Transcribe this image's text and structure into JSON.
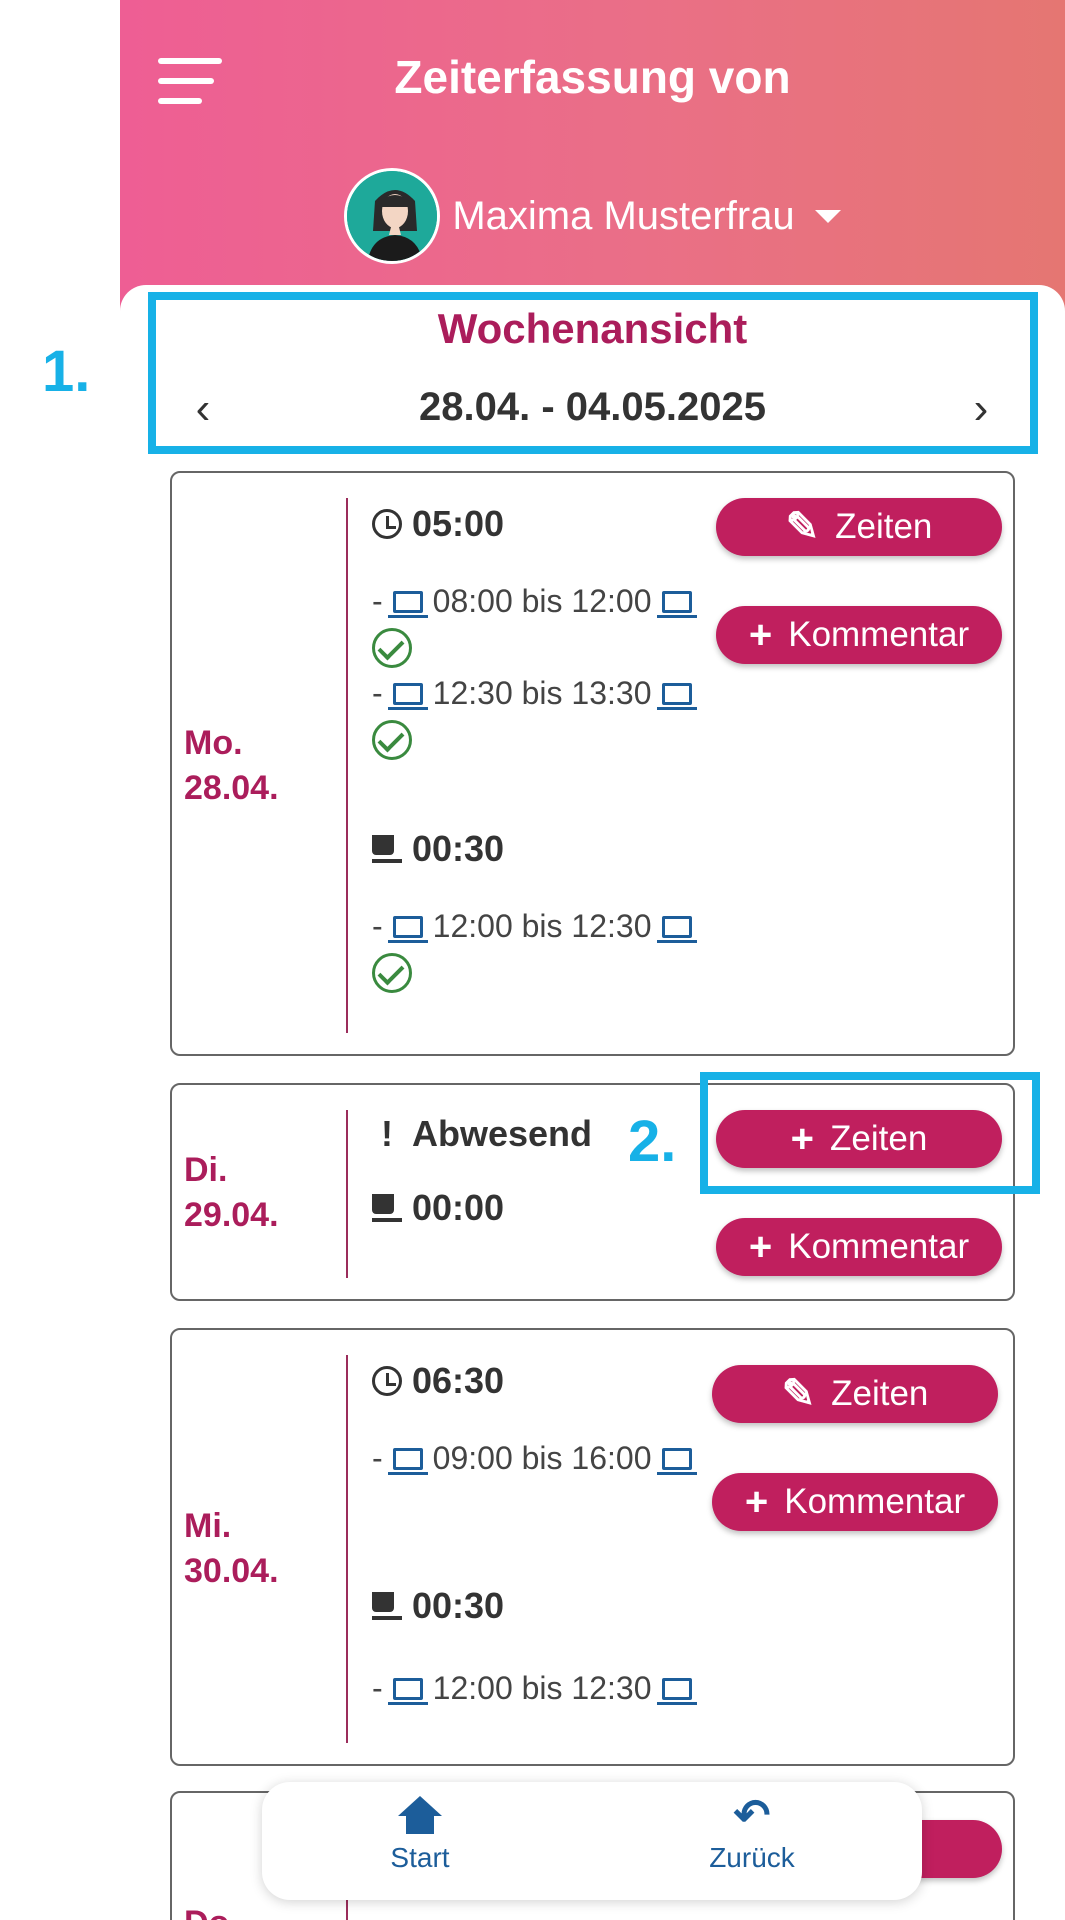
{
  "header": {
    "title": "Zeiterfassung von",
    "user_name": "Maxima Musterfrau"
  },
  "week": {
    "title": "Wochenansicht",
    "range": "28.04. - 04.05.2025",
    "prev": "‹",
    "next": "›"
  },
  "markers": {
    "one": "1.",
    "two": "2."
  },
  "days": [
    {
      "weekday": "Mo.",
      "date": "28.04.",
      "work_total": "05:00",
      "break_total": "00:30",
      "work_slots": [
        {
          "dash": "-",
          "text": "08:00 bis 12:00"
        },
        {
          "dash": "-",
          "text": "12:30 bis 13:30"
        }
      ],
      "break_slots": [
        {
          "dash": "-",
          "text": "12:00 bis 12:30"
        }
      ],
      "times_button": "Zeiten",
      "comment_button": "Kommentar"
    },
    {
      "weekday": "Di.",
      "date": "29.04.",
      "status_mark": "!",
      "status": "Abwesend",
      "break_total": "00:00",
      "times_button": "Zeiten",
      "comment_button": "Kommentar"
    },
    {
      "weekday": "Mi.",
      "date": "30.04.",
      "work_total": "06:30",
      "break_total": "00:30",
      "work_slots": [
        {
          "dash": "-",
          "text": "09:00 bis 16:00"
        }
      ],
      "break_slots": [
        {
          "dash": "-",
          "text": "12:00 bis 12:30"
        }
      ],
      "times_button": "Zeiten",
      "comment_button": "Kommentar"
    },
    {
      "weekday": "Do."
    }
  ],
  "bottom_nav": {
    "start": "Start",
    "back": "Zurück"
  },
  "icons": {
    "menu": "hamburger-icon",
    "edit": "pencil-icon",
    "add": "plus-icon",
    "clock": "clock-icon",
    "break": "coffee-cup-icon",
    "device": "laptop-icon",
    "approved": "check-circle-icon",
    "home": "home-icon",
    "back": "undo-arrow-icon"
  },
  "colors": {
    "accent": "#c01f5e",
    "day_label": "#ab1d5b",
    "highlight": "#17b1e7",
    "icon_blue": "#1c5d9a",
    "check_green": "#3a8a3f"
  }
}
